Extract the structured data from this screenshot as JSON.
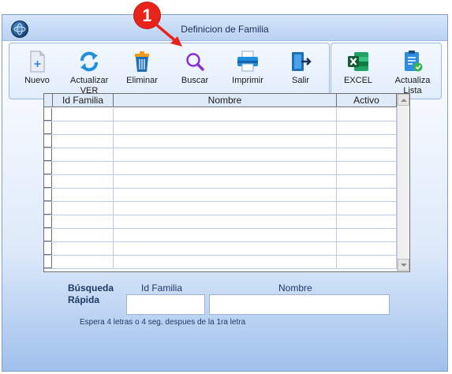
{
  "window": {
    "title": "Definicion de Familia"
  },
  "toolbar": {
    "nuevo": "Nuevo",
    "actualizar": "Actualizar VER",
    "eliminar": "Eliminar",
    "buscar": "Buscar",
    "imprimir": "Imprimir",
    "salir": "Salir",
    "excel": "EXCEL",
    "actualiza_lista": "Actualiza Lista"
  },
  "grid": {
    "columns": [
      "Id Familia",
      "Nombre",
      "Activo"
    ],
    "rows": [
      [
        "",
        "",
        ""
      ],
      [
        "",
        "",
        ""
      ],
      [
        "",
        "",
        ""
      ],
      [
        "",
        "",
        ""
      ],
      [
        "",
        "",
        ""
      ],
      [
        "",
        "",
        ""
      ],
      [
        "",
        "",
        ""
      ],
      [
        "",
        "",
        ""
      ],
      [
        "",
        "",
        ""
      ],
      [
        "",
        "",
        ""
      ],
      [
        "",
        "",
        ""
      ],
      [
        "",
        "",
        ""
      ]
    ]
  },
  "quick_search": {
    "title": "Búsqueda Rápida",
    "id_label": "Id Familia",
    "nombre_label": "Nombre",
    "id_value": "",
    "nombre_value": "",
    "hint": "Espera 4 letras o 4 seg. despues de la 1ra letra"
  },
  "annotation": {
    "step": "1",
    "color": "#e8231a"
  },
  "icons": {
    "logo": "globe-icon",
    "nuevo": "new-document-icon",
    "actualizar": "refresh-icon",
    "eliminar": "trash-icon",
    "buscar": "search-icon",
    "imprimir": "printer-icon",
    "salir": "exit-door-icon",
    "excel": "excel-icon",
    "actualiza_lista": "list-check-icon"
  },
  "colors": {
    "title_bar": "#b9d1f3",
    "grid_header": "#dfeaf8",
    "accent": "#1f3a66"
  }
}
